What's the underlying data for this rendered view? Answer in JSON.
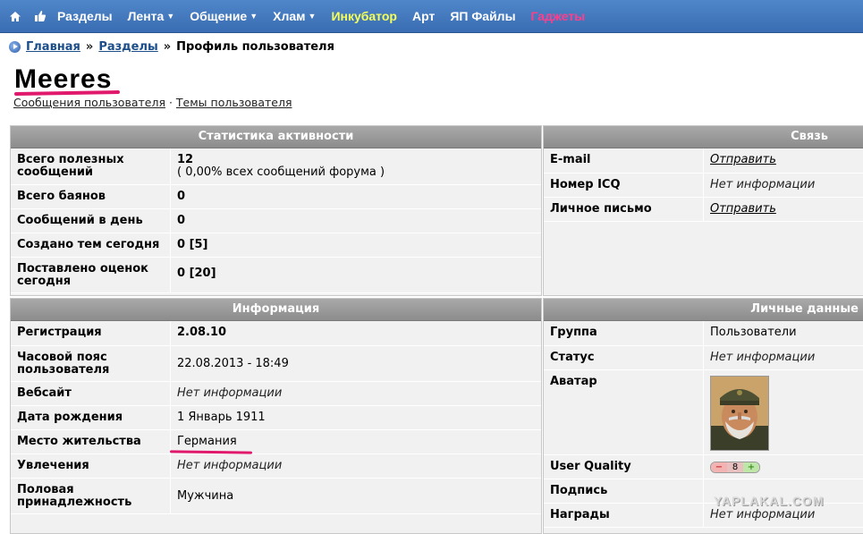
{
  "nav": {
    "items": [
      {
        "label": "Разделы",
        "color": "#ffffff",
        "caret": false
      },
      {
        "label": "Лента",
        "color": "#ffffff",
        "caret": true
      },
      {
        "label": "Общение",
        "color": "#ffffff",
        "caret": true
      },
      {
        "label": "Хлам",
        "color": "#ffffff",
        "caret": true
      },
      {
        "label": "Инкубатор",
        "color": "#f6ff57",
        "caret": false
      },
      {
        "label": "Арт",
        "color": "#ffffff",
        "caret": false
      },
      {
        "label": "ЯП Файлы",
        "color": "#ffffff",
        "caret": false
      },
      {
        "label": "Гаджеты",
        "color": "#ff3d8b",
        "caret": false
      }
    ],
    "icons": [
      "home-icon",
      "like-icon"
    ]
  },
  "breadcrumb": {
    "home": "Главная",
    "sections": "Разделы",
    "sep": "»",
    "current": "Профиль пользователя"
  },
  "profile": {
    "username": "Meeres",
    "links": {
      "posts": "Сообщения пользователя",
      "dot": "·",
      "topics": "Темы пользователя"
    }
  },
  "stats": {
    "title": "Статистика активности",
    "rows": [
      {
        "label": "Всего полезных сообщений",
        "value": "12",
        "sub": "( 0,00% всех сообщений форума )"
      },
      {
        "label": "Всего баянов",
        "value": "0"
      },
      {
        "label": "Сообщений в день",
        "value": "0"
      },
      {
        "label": "Создано тем сегодня",
        "value": "0 [5]"
      },
      {
        "label": "Поставлено оценок сегодня",
        "value": "0 [20]"
      }
    ]
  },
  "contact": {
    "title": "Связь",
    "rows": [
      {
        "label": "E-mail",
        "value": "Отправить"
      },
      {
        "label": "Номер ICQ",
        "value": "Нет информации"
      },
      {
        "label": "Личное письмо",
        "value": "Отправить"
      }
    ]
  },
  "info": {
    "title": "Информация",
    "rows": [
      {
        "label": "Регистрация",
        "value": "2.08.10"
      },
      {
        "label": "Часовой пояс пользователя",
        "value": "22.08.2013 - 18:49"
      },
      {
        "label": "Вебсайт",
        "value": "Нет информации"
      },
      {
        "label": "Дата рождения",
        "value": "1 Январь 1911"
      },
      {
        "label": "Место жительства",
        "value": "Германия"
      },
      {
        "label": "Увлечения",
        "value": "Нет информации"
      },
      {
        "label": "Половая принадлежность",
        "value": "Мужчина"
      }
    ]
  },
  "personal": {
    "title": "Личные данные",
    "rows": [
      {
        "label": "Группа",
        "value": "Пользователи"
      },
      {
        "label": "Статус",
        "value": "Нет информации"
      },
      {
        "label": "Аватар"
      },
      {
        "label": "User Quality",
        "minus": "−",
        "value": "8",
        "plus": "+"
      },
      {
        "label": "Подпись",
        "value": ""
      },
      {
        "label": "Награды",
        "value": "Нет информации"
      }
    ]
  },
  "watermark": "YAPLAKAL.COM",
  "colors": {
    "accent_underline": "#e0196c",
    "nav_bg": "#3a6db3",
    "header_gray": "#999999"
  }
}
